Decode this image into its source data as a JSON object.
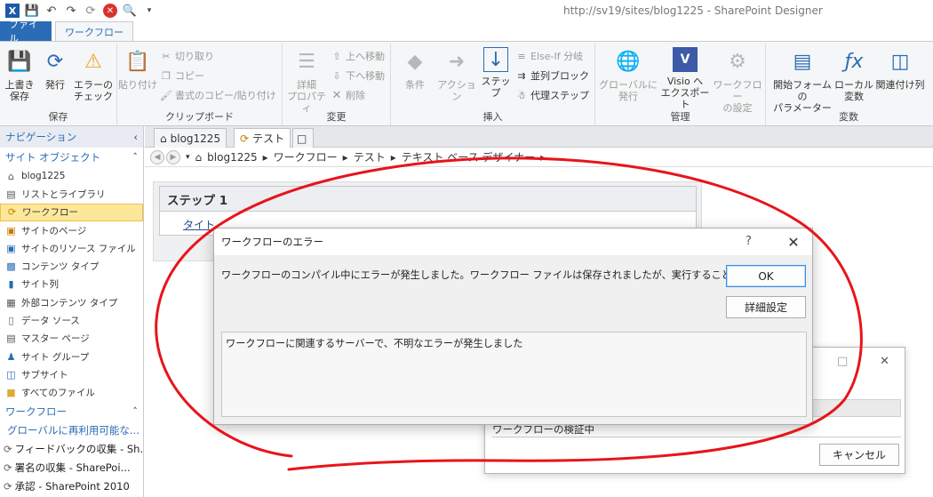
{
  "window": {
    "title": "http://sv19/sites/blog1225 - SharePoint Designer"
  },
  "ribbon_tabs": [
    {
      "label": "ファイル"
    },
    {
      "label": "ワークフロー"
    }
  ],
  "ribbon": {
    "save": {
      "save_label": "上書き\n保存",
      "publish_label": "発行",
      "check_label": "エラーの\nチェック",
      "group_label": "保存"
    },
    "clipboard": {
      "paste_label": "貼り付け",
      "cut_label": "切り取り",
      "copy_label": "コピー",
      "format_label": "書式のコピー/貼り付け",
      "group_label": "クリップボード"
    },
    "modify": {
      "properties_label": "詳細\nプロパティ",
      "move_up_label": "上へ移動",
      "move_down_label": "下へ移動",
      "delete_label": "削除",
      "group_label": "変更"
    },
    "insert": {
      "condition_label": "条件",
      "action_label": "アクション",
      "step_label": "ステップ",
      "elseif_label": "Else-If 分岐",
      "parallel_label": "並列ブロック",
      "impersonation_label": "代理ステップ",
      "group_label": "挿入"
    },
    "manage": {
      "global_label": "グローバルに\n発行",
      "visio_label": "Visio へ\nエクスポート",
      "settings_label": "ワークフロー\nの設定",
      "group_label": "管理"
    },
    "variables": {
      "init_label": "開始フォームの\nパラメーター",
      "local_label": "ローカル\n変数",
      "assoc_label": "関連付け列",
      "group_label": "変数"
    }
  },
  "nav": {
    "header": "ナビゲーション",
    "section_site_objects": "サイト オブジェクト",
    "items": [
      {
        "label": "blog1225",
        "icon": "home-icon"
      },
      {
        "label": "リストとライブラリ",
        "icon": "list-icon"
      },
      {
        "label": "ワークフロー",
        "icon": "workflow-icon",
        "selected": true
      },
      {
        "label": "サイトのページ",
        "icon": "page-icon"
      },
      {
        "label": "サイトのリソース ファイル",
        "icon": "resource-icon"
      },
      {
        "label": "コンテンツ タイプ",
        "icon": "content-type-icon"
      },
      {
        "label": "サイト列",
        "icon": "column-icon"
      },
      {
        "label": "外部コンテンツ タイプ",
        "icon": "external-icon"
      },
      {
        "label": "データ ソース",
        "icon": "database-icon"
      },
      {
        "label": "マスター ページ",
        "icon": "master-page-icon"
      },
      {
        "label": "サイト グループ",
        "icon": "group-icon"
      },
      {
        "label": "サブサイト",
        "icon": "subsite-icon"
      },
      {
        "label": "すべてのファイル",
        "icon": "folder-icon"
      }
    ],
    "section_workflows": "ワークフロー",
    "workflows": [
      {
        "label": "グローバルに再利用可能な..."
      },
      {
        "label": "フィードバックの収集 - Sh..."
      },
      {
        "label": "署名の収集 - SharePoi..."
      },
      {
        "label": "承認 - SharePoint 2010"
      }
    ]
  },
  "doc_tabs": [
    {
      "label": "blog1225"
    },
    {
      "label": "テスト"
    }
  ],
  "breadcrumb": {
    "items": [
      "blog1225",
      "ワークフロー",
      "テスト",
      "テキスト ベース デザイナー"
    ]
  },
  "designer": {
    "step_title": "ステップ 1",
    "step_body": "タイト"
  },
  "error_dialog": {
    "title": "ワークフローのエラー",
    "help": "?",
    "message": "ワークフローのコンパイル中にエラーが発生しました。ワークフロー ファイルは保存されましたが、実行することはできません。",
    "ok_label": "OK",
    "details_label": "詳細設定",
    "details_text": "ワークフローに関連するサーバーで、不明なエラーが発生しました"
  },
  "validation_dialog": {
    "status_text": "ワークフローの検証中",
    "cancel_label": "キャンセル"
  },
  "colors": {
    "accent": "#2a6cb6",
    "annotation": "#e8141b",
    "selected_nav": "#fde79a"
  }
}
